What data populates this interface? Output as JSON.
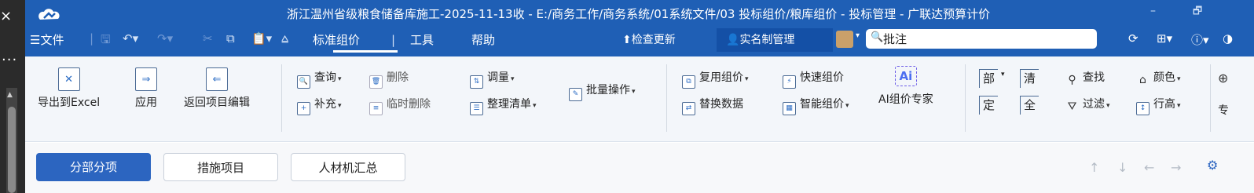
{
  "left_strip": {
    "close_glyph": "×",
    "more_glyph": "···"
  },
  "title_bar": {
    "title": "浙江温州省级粮食储备库施工-2025-11-13收 - E:/商务工作/商务系统/01系统文件/03 投标组价/粮库组价 - 投标管理 - 广联达预算计价",
    "minimize": "–",
    "maximize": "🗗"
  },
  "menu": {
    "file_label": "文件",
    "tabs": [
      "标准组价",
      "工具",
      "帮助"
    ],
    "check_update": "检查更新",
    "realname": "实名制管理",
    "search_value": "批注"
  },
  "ribbon": {
    "export_excel": "导出到Excel",
    "apply": "应用",
    "return_edit": "返回项目编辑",
    "query": "查询",
    "supplement": "补充",
    "delete": "删除",
    "temp_delete": "临时删除",
    "adjust_qty": "调量",
    "organize_list": "整理清单",
    "batch_ops": "批量操作",
    "reuse_price": "复用组价",
    "replace_data": "替换数据",
    "quick_price": "快速组价",
    "smart_price": "智能组价",
    "ai_expert": "AI组价专家",
    "ai_badge": "Ai",
    "sq_bu": "部",
    "sq_qing": "清",
    "sq_ding": "定",
    "sq_quan": "全",
    "find": "查找",
    "filter": "过滤",
    "color": "颜色",
    "row_height": "行高",
    "more_cut": "专"
  },
  "bottom_tabs": [
    "分部分项",
    "措施项目",
    "人材机汇总"
  ],
  "colors": {
    "title_bg": "#1f5fb5",
    "active_tab": "#2c65c0",
    "ribbon_bg": "#f3f6fa"
  }
}
